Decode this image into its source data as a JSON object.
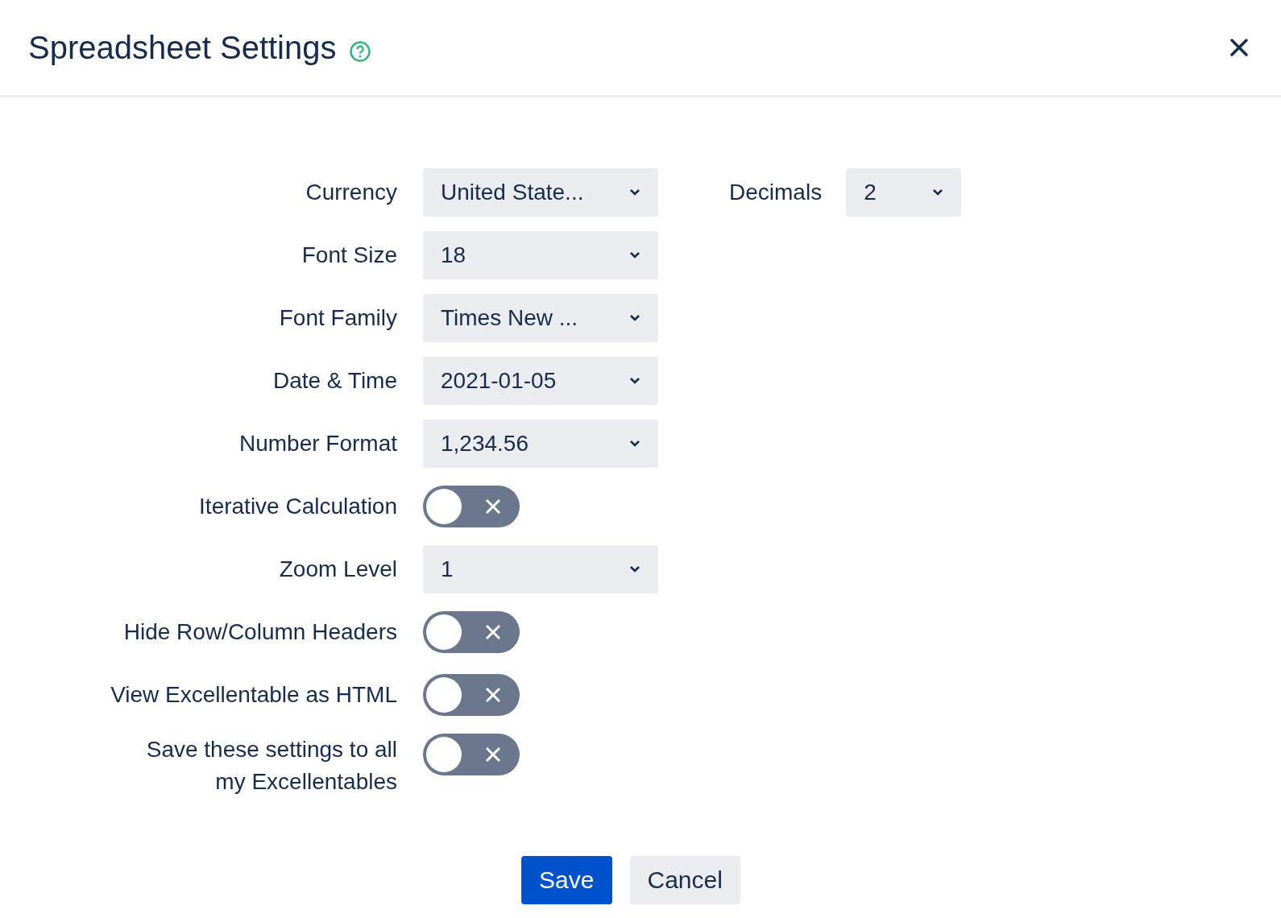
{
  "dialog": {
    "title": "Spreadsheet Settings"
  },
  "fields": [
    {
      "kind": "select",
      "label": "Currency",
      "value": "United State..."
    },
    {
      "kind": "select",
      "label": "Font Size",
      "value": "18"
    },
    {
      "kind": "select",
      "label": "Font Family",
      "value": "Times New ..."
    },
    {
      "kind": "select",
      "label": "Date & Time",
      "value": "2021-01-05"
    },
    {
      "kind": "select",
      "label": "Number Format",
      "value": "1,234.56"
    },
    {
      "kind": "toggle",
      "label": "Iterative Calculation",
      "on": false
    },
    {
      "kind": "select",
      "label": "Zoom Level",
      "value": "1"
    },
    {
      "kind": "toggle",
      "label": "Hide Row/Column Headers",
      "on": false
    },
    {
      "kind": "toggle",
      "label": "View Excellentable as HTML",
      "on": false
    },
    {
      "kind": "toggle",
      "label": "Save these settings to all my Excellentables",
      "on": false
    }
  ],
  "decimals": {
    "label": "Decimals",
    "value": "2"
  },
  "buttons": [
    {
      "kind": "primary",
      "label": "Save"
    },
    {
      "kind": "secondary",
      "label": "Cancel"
    }
  ]
}
